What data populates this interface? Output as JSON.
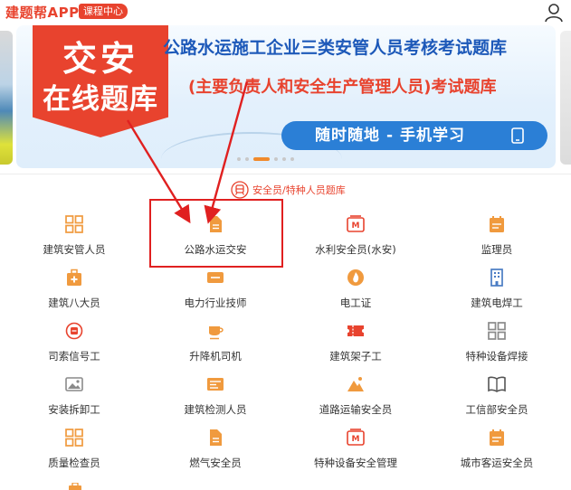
{
  "header": {
    "brand": "建题帮APP",
    "course_badge": "课程中心",
    "user_icon": "user-icon"
  },
  "banner": {
    "tag_line1": "交安",
    "tag_line2": "在线题库",
    "title": "公路水运施工企业三类安管人员考核考试题库",
    "subtitle": "(主要负责人和安全生产管理人员)考试题库",
    "pill_text": "随时随地 - 手机学习",
    "pill_icon": "tablet-icon",
    "active_slide": 2,
    "slide_count": 6
  },
  "section": {
    "title": "安全员/特种人员题库",
    "icon": "train-icon"
  },
  "colors": {
    "accent": "#e8432e",
    "icon_orange": "#f09a3e",
    "icon_gray": "#8a8a8a",
    "banner_blue": "#1d59b9",
    "pill_blue": "#2b7fd6",
    "highlight_red": "#e02020"
  },
  "items": [
    {
      "label": "建筑安管人员",
      "icon": "grid-icon"
    },
    {
      "label": "公路水运交安",
      "icon": "document-icon"
    },
    {
      "label": "水利安全员(水安)",
      "icon": "m-badge-icon"
    },
    {
      "label": "监理员",
      "icon": "calendar-icon"
    },
    {
      "label": "建筑八大员",
      "icon": "medical-kit-icon"
    },
    {
      "label": "电力行业技师",
      "icon": "tag-icon"
    },
    {
      "label": "电工证",
      "icon": "flame-icon"
    },
    {
      "label": "建筑电焊工",
      "icon": "building-icon"
    },
    {
      "label": "司索信号工",
      "icon": "signal-icon"
    },
    {
      "label": "升降机司机",
      "icon": "cup-icon"
    },
    {
      "label": "建筑架子工",
      "icon": "ticket-icon"
    },
    {
      "label": "特种设备焊接",
      "icon": "grid-icon"
    },
    {
      "label": "安装拆卸工",
      "icon": "image-icon"
    },
    {
      "label": "建筑检测人员",
      "icon": "id-card-icon"
    },
    {
      "label": "道路运输安全员",
      "icon": "mountain-icon"
    },
    {
      "label": "工信部安全员",
      "icon": "book-icon"
    },
    {
      "label": "质量检查员",
      "icon": "grid-icon"
    },
    {
      "label": "燃气安全员",
      "icon": "document-icon"
    },
    {
      "label": "特种设备安全管理",
      "icon": "m-badge-icon"
    },
    {
      "label": "城市客运安全员",
      "icon": "calendar-icon"
    }
  ]
}
